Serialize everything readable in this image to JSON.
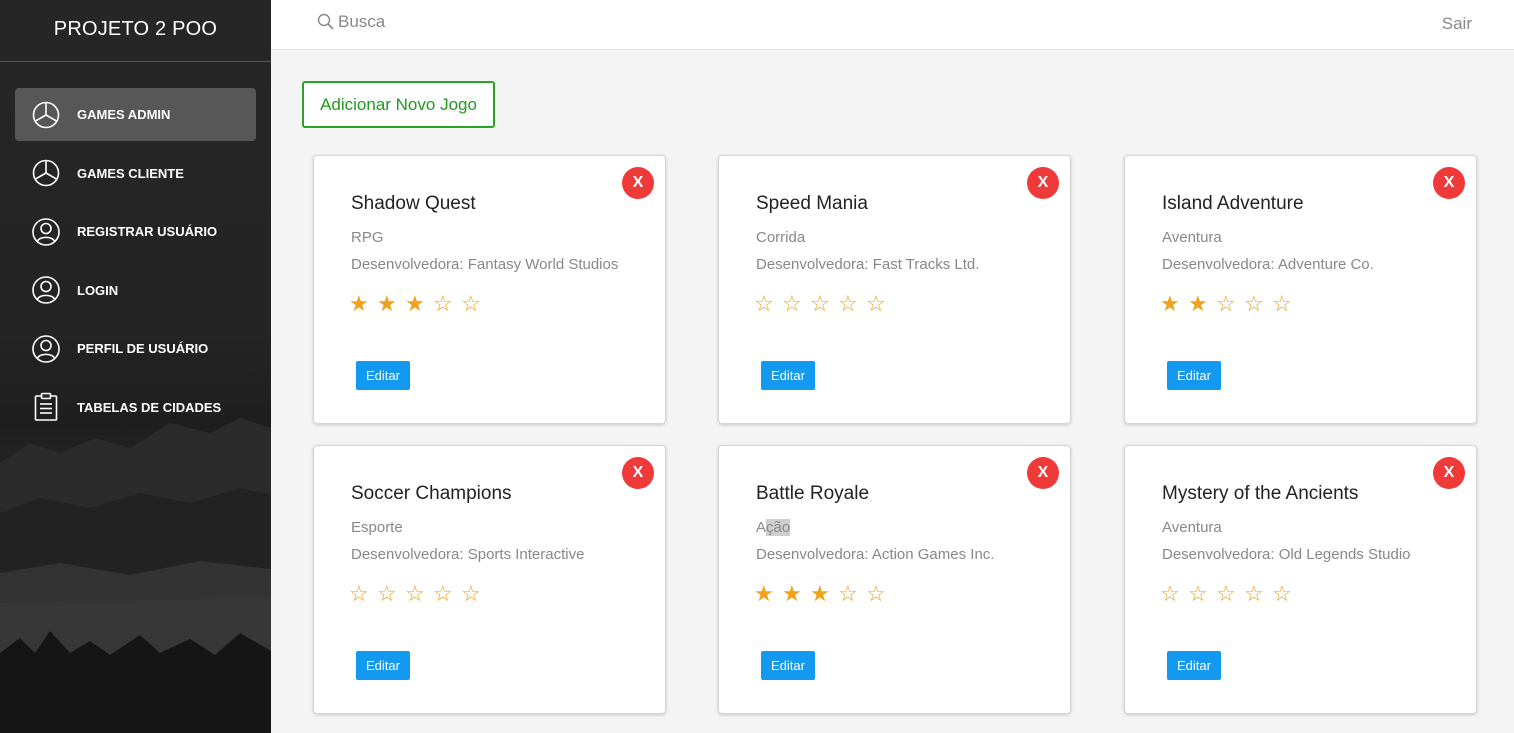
{
  "brand": "PROJETO 2 POO",
  "sidebar": {
    "items": [
      {
        "label": "GAMES ADMIN",
        "icon": "pie-chart-icon",
        "active": true
      },
      {
        "label": "GAMES CLIENTE",
        "icon": "pie-chart-icon",
        "active": false
      },
      {
        "label": "REGISTRAR USUÁRIO",
        "icon": "user-circle-icon",
        "active": false
      },
      {
        "label": "LOGIN",
        "icon": "user-circle-icon",
        "active": false
      },
      {
        "label": "PERFIL DE USUÁRIO",
        "icon": "user-circle-icon",
        "active": false
      },
      {
        "label": "TABELAS DE CIDADES",
        "icon": "clipboard-icon",
        "active": false
      }
    ]
  },
  "topbar": {
    "search_placeholder": "Busca",
    "logout_label": "Sair"
  },
  "main": {
    "add_button_label": "Adicionar Novo Jogo",
    "close_label": "X",
    "edit_label": "Editar",
    "dev_prefix": "Desenvolvedora: ",
    "games": [
      {
        "title": "Shadow Quest",
        "genre": "RPG",
        "developer": "Desenvolvedora: Fantasy World Studios",
        "rating": 3,
        "max_rating": 5
      },
      {
        "title": "Speed Mania",
        "genre": "Corrida",
        "developer": "Desenvolvedora: Fast Tracks Ltd.",
        "rating": 0,
        "max_rating": 5
      },
      {
        "title": "Island Adventure",
        "genre": "Aventura",
        "developer": "Desenvolvedora: Adventure Co.",
        "rating": 2,
        "max_rating": 5
      },
      {
        "title": "Soccer Champions",
        "genre": "Esporte",
        "developer": "Desenvolvedora: Sports Interactive",
        "rating": 0,
        "max_rating": 5
      },
      {
        "title": "Battle Royale",
        "genre_prefix": "A",
        "genre_selected": "ção",
        "genre": "Ação",
        "developer": "Desenvolvedora: Action Games Inc.",
        "rating": 3,
        "max_rating": 5
      },
      {
        "title": "Mystery of the Ancients",
        "genre": "Aventura",
        "developer": "Desenvolvedora: Old Legends Studio",
        "rating": 0,
        "max_rating": 5
      }
    ]
  },
  "colors": {
    "add_button": "#28a428",
    "edit_button": "#1399ef",
    "close_button": "#f03a3a",
    "star": "#f0a21a"
  }
}
